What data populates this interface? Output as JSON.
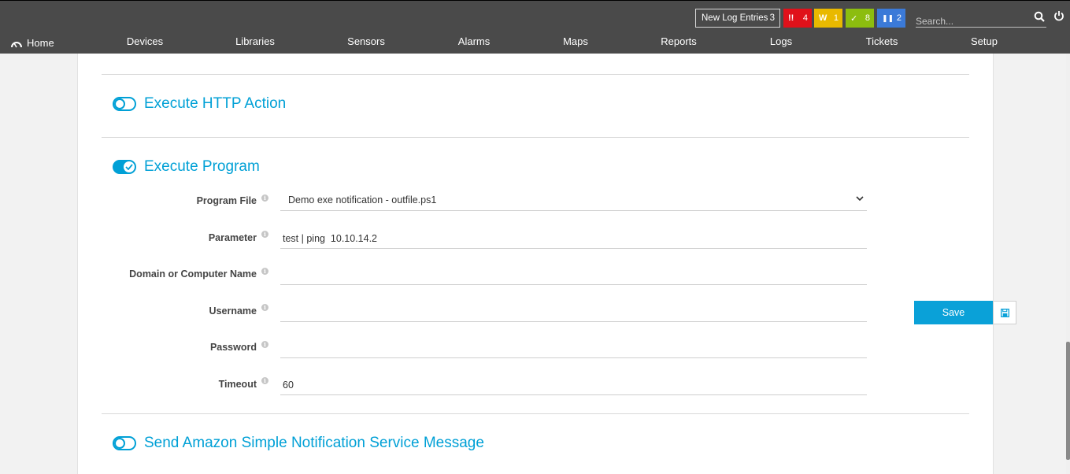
{
  "topbar": {
    "home_label": "Home",
    "nav": [
      "Devices",
      "Libraries",
      "Sensors",
      "Alarms",
      "Maps",
      "Reports",
      "Logs",
      "Tickets",
      "Setup"
    ],
    "log_entries_label": "New Log Entries",
    "log_entries_count": "3",
    "badges": [
      {
        "icon": "!!",
        "count": "4",
        "color": "#e0111a",
        "name": "error"
      },
      {
        "icon": "W",
        "count": "1",
        "color": "#e9b900",
        "name": "warning"
      },
      {
        "icon": "✓",
        "count": "8",
        "color": "#8cbd0f",
        "name": "ok"
      },
      {
        "icon": "❚❚",
        "count": "2",
        "color": "#3b7ad8",
        "name": "paused"
      }
    ],
    "search_placeholder": "Search..."
  },
  "sections": {
    "http": {
      "title": "Execute HTTP Action",
      "enabled": false
    },
    "program": {
      "title": "Execute Program",
      "enabled": true
    },
    "sns": {
      "title": "Send Amazon Simple Notification Service Message",
      "enabled": false
    }
  },
  "form": {
    "program_file_label": "Program File",
    "program_file_value": "Demo exe notification - outfile.ps1",
    "parameter_label": "Parameter",
    "parameter_value": "test | ping  10.10.14.2",
    "domain_label": "Domain or Computer Name",
    "domain_value": "",
    "username_label": "Username",
    "username_value": "",
    "password_label": "Password",
    "password_value": "",
    "timeout_label": "Timeout",
    "timeout_value": "60"
  },
  "actions": {
    "save_label": "Save"
  },
  "colors": {
    "accent": "#00a0d6",
    "topbar": "#4a4a4a"
  }
}
